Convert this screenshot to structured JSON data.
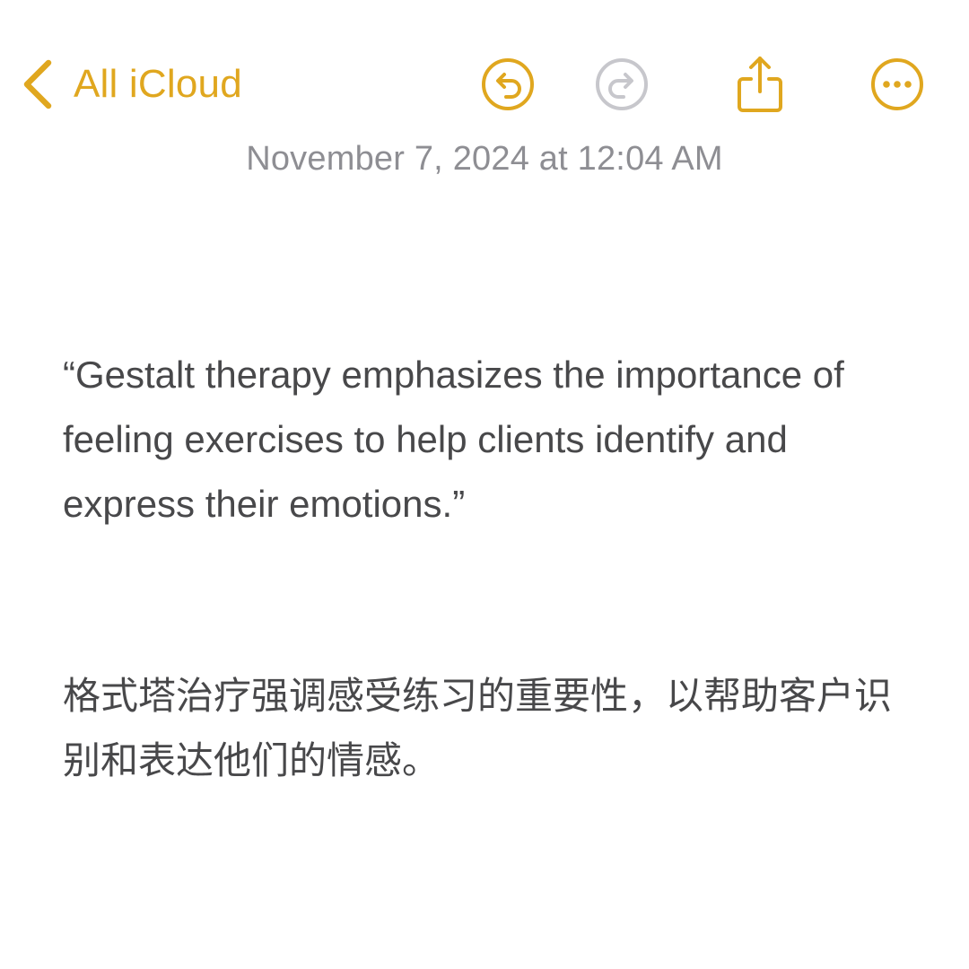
{
  "toolbar": {
    "back_label": "All iCloud",
    "icons": {
      "back": "chevron-left-icon",
      "undo": "undo-icon",
      "redo": "redo-icon",
      "share": "share-icon",
      "more": "ellipsis-circle-icon"
    },
    "accent_color": "#e0a71f",
    "disabled_color": "#c7c7cc"
  },
  "note": {
    "timestamp": "November 7, 2024 at 12:04 AM",
    "paragraphs": [
      "“Gestalt therapy emphasizes the importance of feeling exercises to help clients identify and express their emotions.”",
      "格式塔治疗强调感受练习的重要性，以帮助客户识别和表达他们的情感。"
    ]
  }
}
